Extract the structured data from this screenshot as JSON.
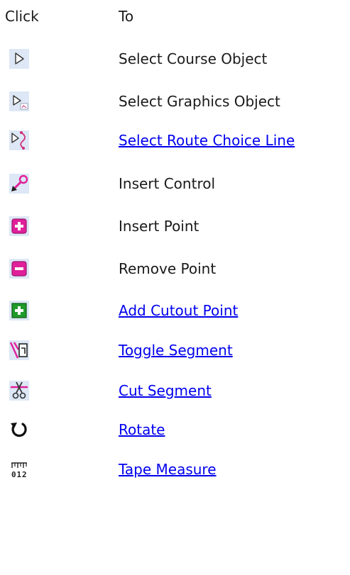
{
  "header": {
    "click": "Click",
    "to": "To"
  },
  "rows": [
    {
      "icon": "select-course-object-icon",
      "label": "Select Course Object",
      "link": false
    },
    {
      "icon": "select-graphics-object-icon",
      "label": "Select Graphics Object",
      "link": false
    },
    {
      "icon": "select-route-choice-line-icon",
      "label": "Select Route Choice Line",
      "link": true
    },
    {
      "icon": "insert-control-icon",
      "label": "Insert Control",
      "link": false
    },
    {
      "icon": "insert-point-icon",
      "label": "Insert Point",
      "link": false
    },
    {
      "icon": "remove-point-icon",
      "label": "Remove Point",
      "link": false
    },
    {
      "icon": "add-cutout-point-icon",
      "label": "Add Cutout Point",
      "link": true
    },
    {
      "icon": "toggle-segment-icon",
      "label": "Toggle Segment",
      "link": true
    },
    {
      "icon": "cut-segment-icon",
      "label": "Cut Segment",
      "link": true
    },
    {
      "icon": "rotate-icon",
      "label": "Rotate",
      "link": true
    },
    {
      "icon": "tape-measure-icon",
      "label": "Tape Measure",
      "link": true
    }
  ],
  "colors": {
    "link": "#0000ee",
    "magenta": "#e0209a",
    "green": "#1f9a2a",
    "icon_bg": "#dde7f5"
  }
}
